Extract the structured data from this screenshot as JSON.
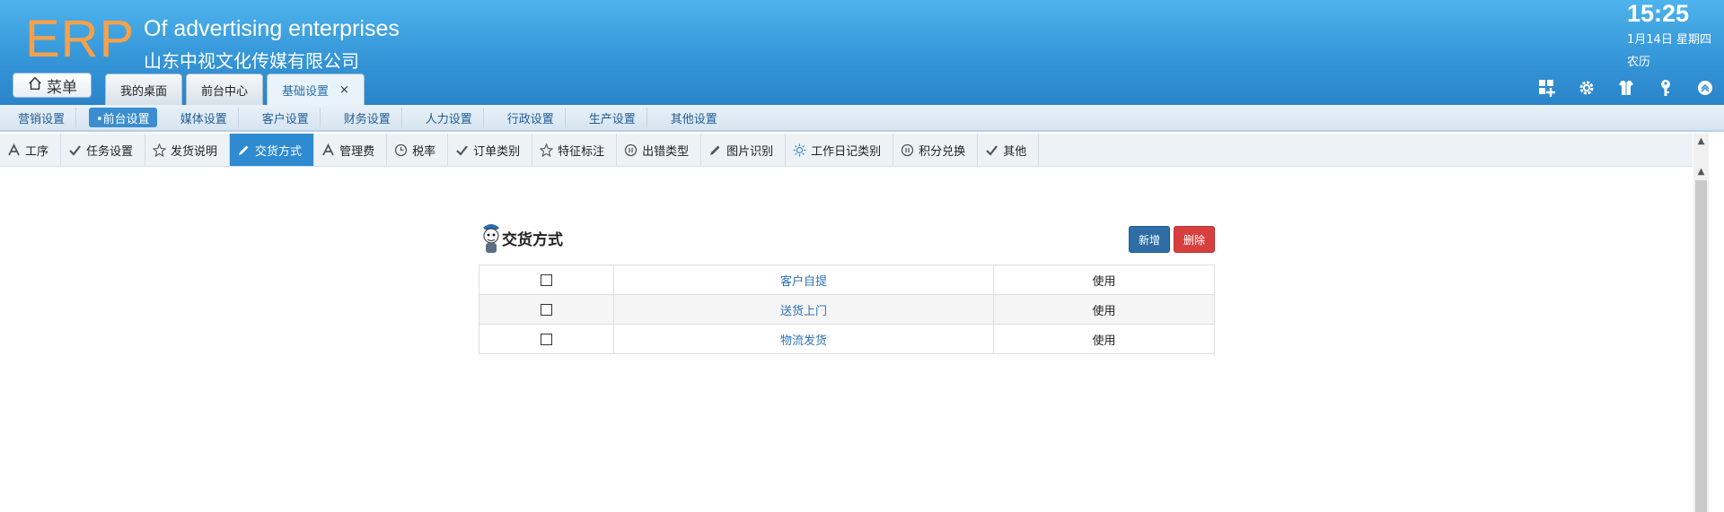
{
  "header": {
    "logo": "ERP",
    "company_en": "Of advertising enterprises",
    "company_cn": "山东中视文化传媒有限公司",
    "menu_label": "菜单",
    "time": "15:25",
    "date": "1月14日 星期四",
    "lunar": "农历",
    "tabs": [
      {
        "label": "我的桌面"
      },
      {
        "label": "前台中心"
      },
      {
        "label": "基础设置",
        "close": "×"
      }
    ],
    "icons": [
      "grid-add-icon",
      "gear-icon",
      "shirt-icon",
      "key-icon",
      "collapse-up-icon"
    ]
  },
  "module_nav": {
    "items": [
      "营销设置",
      "•前台设置",
      "媒体设置",
      "客户设置",
      "财务设置",
      "人力设置",
      "行政设置",
      "生产设置",
      "其他设置"
    ],
    "active_index": 1
  },
  "sub_tabs": {
    "items": [
      {
        "label": "工序",
        "icon": "letter-a-icon"
      },
      {
        "label": "任务设置",
        "icon": "check-icon"
      },
      {
        "label": "发货说明",
        "icon": "star-icon"
      },
      {
        "label": "交货方式",
        "icon": "pencil-icon"
      },
      {
        "label": "管理费",
        "icon": "letter-a-icon"
      },
      {
        "label": "税率",
        "icon": "clock-icon"
      },
      {
        "label": "订单类别",
        "icon": "check-icon"
      },
      {
        "label": "特征标注",
        "icon": "star-icon"
      },
      {
        "label": "出错类型",
        "icon": "pause-circle-icon"
      },
      {
        "label": "图片识别",
        "icon": "pencil-icon"
      },
      {
        "label": "工作日记类别",
        "icon": "sun-icon"
      },
      {
        "label": "积分兑换",
        "icon": "pause-circle-icon"
      },
      {
        "label": "其他",
        "icon": "check-icon"
      }
    ],
    "active_index": 3
  },
  "panel": {
    "title": "交货方式",
    "add_label": "新增",
    "delete_label": "删除",
    "rows": [
      {
        "name": "客户自提",
        "status": "使用"
      },
      {
        "name": "送货上门",
        "status": "使用"
      },
      {
        "name": "物流发货",
        "status": "使用"
      }
    ]
  },
  "colors": {
    "header_blue": "#3596d8",
    "logo_orange": "#f6a14a",
    "active_tab_blue": "#2e8bd2",
    "add_button": "#2f6da5",
    "delete_button": "#d73f3f",
    "link_blue": "#2f72b5"
  }
}
